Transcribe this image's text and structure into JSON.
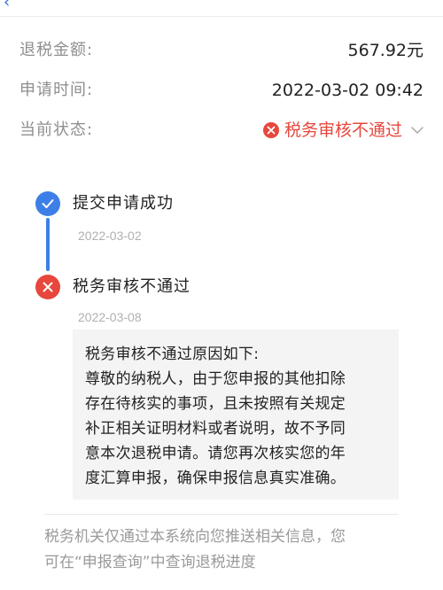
{
  "summary": {
    "amount_label": "退税金额:",
    "amount_value": "567.92元",
    "time_label": "申请时间:",
    "time_value": "2022-03-02 09:42",
    "status_label": "当前状态:",
    "status_value": "税务审核不通过"
  },
  "timeline": {
    "steps": [
      {
        "title": "提交申请成功",
        "date": "2022-03-02",
        "icon": "check-icon"
      },
      {
        "title": "税务审核不通过",
        "date": "2022-03-08",
        "icon": "close-icon"
      }
    ],
    "reason_lines": [
      "税务审核不通过原因如下:",
      "尊敬的纳税人，由于您申报的其他扣除",
      "存在待核实的事项，且未按照有关规定",
      "补正相关证明材料或者说明，故不予同",
      "意本次退税申请。请您再次核实您的年",
      "度汇算申报，确保申报信息真实准确。"
    ]
  },
  "footer": {
    "lines": [
      "税务机关仅通过本系统向您推送相关信息，您",
      "可在“申报查询”中查询退税进度"
    ]
  },
  "colors": {
    "accent_blue": "#3d7fe6",
    "error_red": "#e7473c",
    "label_gray": "#8f8f8f"
  }
}
